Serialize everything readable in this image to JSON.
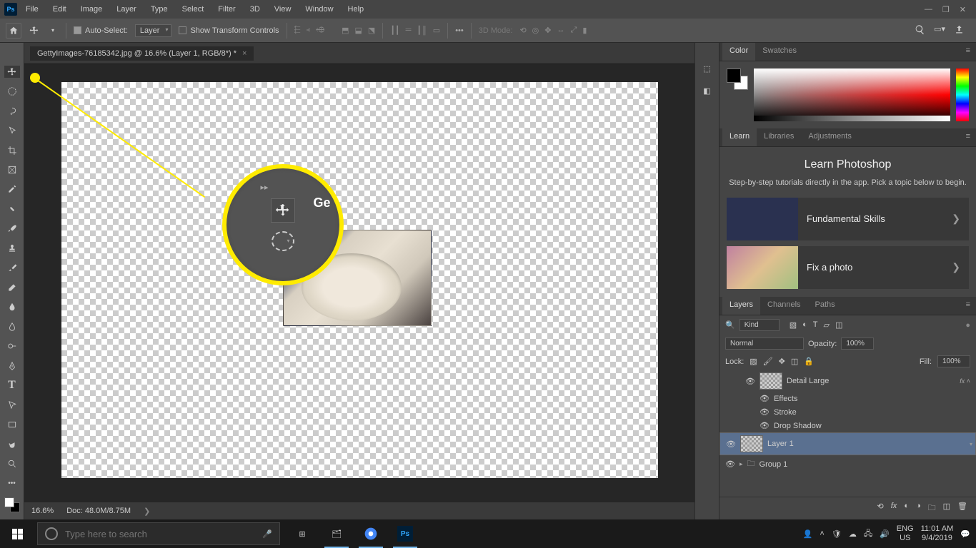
{
  "menubar": {
    "items": [
      "File",
      "Edit",
      "Image",
      "Layer",
      "Type",
      "Select",
      "Filter",
      "3D",
      "View",
      "Window",
      "Help"
    ]
  },
  "optbar": {
    "auto_select": "Auto-Select:",
    "layer_target": "Layer",
    "show_transform": "Show Transform Controls",
    "mode_3d": "3D Mode:"
  },
  "tab": {
    "title": "GettyImages-76185342.jpg @ 16.6% (Layer 1, RGB/8*) *"
  },
  "callout": {
    "label": "Ge"
  },
  "statusbar": {
    "zoom": "16.6%",
    "doc": "Doc: 48.0M/8.75M"
  },
  "color_panel": {
    "tabs": [
      "Color",
      "Swatches"
    ]
  },
  "learn_panel": {
    "tabs": [
      "Learn",
      "Libraries",
      "Adjustments"
    ],
    "title": "Learn Photoshop",
    "sub": "Step-by-step tutorials directly in the app. Pick a topic below to begin.",
    "items": [
      "Fundamental Skills",
      "Fix a photo"
    ]
  },
  "layers_panel": {
    "tabs": [
      "Layers",
      "Channels",
      "Paths"
    ],
    "kind": "Kind",
    "blend": "Normal",
    "opacity_label": "Opacity:",
    "opacity": "100%",
    "lock_label": "Lock:",
    "fill_label": "Fill:",
    "fill": "100%",
    "items": {
      "detail": "Detail Large",
      "effects": "Effects",
      "stroke": "Stroke",
      "shadow": "Drop Shadow",
      "layer1": "Layer 1",
      "group1": "Group 1"
    }
  },
  "taskbar": {
    "search_placeholder": "Type here to search",
    "lang1": "ENG",
    "lang2": "US",
    "time": "11:01 AM",
    "date": "9/4/2019"
  }
}
